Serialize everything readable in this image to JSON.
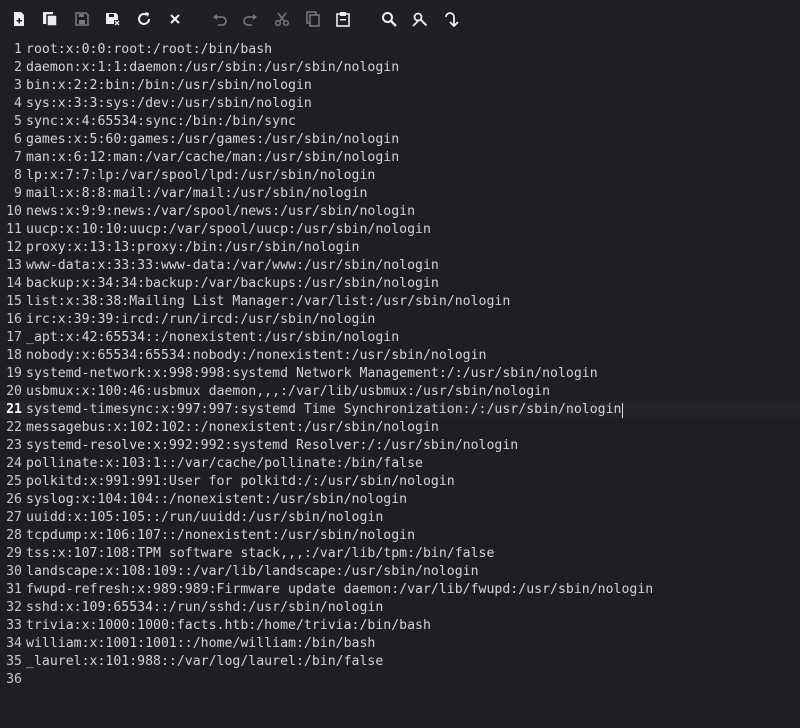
{
  "toolbar": {
    "buttons": [
      {
        "icon": "new-file-icon"
      },
      {
        "icon": "new-window-icon"
      },
      {
        "icon": "save-icon"
      },
      {
        "icon": "save-as-icon"
      },
      {
        "icon": "reload-icon"
      },
      {
        "icon": "close-icon"
      },
      {
        "icon": "undo-icon"
      },
      {
        "icon": "redo-icon"
      },
      {
        "icon": "cut-icon"
      },
      {
        "icon": "copy-icon"
      },
      {
        "icon": "paste-icon"
      },
      {
        "icon": "find-icon"
      },
      {
        "icon": "find-replace-icon"
      },
      {
        "icon": "goto-line-icon"
      }
    ]
  },
  "editor": {
    "active_line": 21,
    "lines": [
      {
        "n": "1",
        "text": "root:x:0:0:root:/root:/bin/bash"
      },
      {
        "n": "2",
        "text": "daemon:x:1:1:daemon:/usr/sbin:/usr/sbin/nologin"
      },
      {
        "n": "3",
        "text": "bin:x:2:2:bin:/bin:/usr/sbin/nologin"
      },
      {
        "n": "4",
        "text": "sys:x:3:3:sys:/dev:/usr/sbin/nologin"
      },
      {
        "n": "5",
        "text": "sync:x:4:65534:sync:/bin:/bin/sync"
      },
      {
        "n": "6",
        "text": "games:x:5:60:games:/usr/games:/usr/sbin/nologin"
      },
      {
        "n": "7",
        "text": "man:x:6:12:man:/var/cache/man:/usr/sbin/nologin"
      },
      {
        "n": "8",
        "text": "lp:x:7:7:lp:/var/spool/lpd:/usr/sbin/nologin"
      },
      {
        "n": "9",
        "text": "mail:x:8:8:mail:/var/mail:/usr/sbin/nologin"
      },
      {
        "n": "10",
        "text": "news:x:9:9:news:/var/spool/news:/usr/sbin/nologin"
      },
      {
        "n": "11",
        "text": "uucp:x:10:10:uucp:/var/spool/uucp:/usr/sbin/nologin"
      },
      {
        "n": "12",
        "text": "proxy:x:13:13:proxy:/bin:/usr/sbin/nologin"
      },
      {
        "n": "13",
        "text": "www-data:x:33:33:www-data:/var/www:/usr/sbin/nologin"
      },
      {
        "n": "14",
        "text": "backup:x:34:34:backup:/var/backups:/usr/sbin/nologin"
      },
      {
        "n": "15",
        "text": "list:x:38:38:Mailing List Manager:/var/list:/usr/sbin/nologin"
      },
      {
        "n": "16",
        "text": "irc:x:39:39:ircd:/run/ircd:/usr/sbin/nologin"
      },
      {
        "n": "17",
        "text": "_apt:x:42:65534::/nonexistent:/usr/sbin/nologin"
      },
      {
        "n": "18",
        "text": "nobody:x:65534:65534:nobody:/nonexistent:/usr/sbin/nologin"
      },
      {
        "n": "19",
        "text": "systemd-network:x:998:998:systemd Network Management:/:/usr/sbin/nologin"
      },
      {
        "n": "20",
        "text": "usbmux:x:100:46:usbmux daemon,,,:/var/lib/usbmux:/usr/sbin/nologin"
      },
      {
        "n": "21",
        "text": "systemd-timesync:x:997:997:systemd Time Synchronization:/:/usr/sbin/nologin"
      },
      {
        "n": "22",
        "text": "messagebus:x:102:102::/nonexistent:/usr/sbin/nologin"
      },
      {
        "n": "23",
        "text": "systemd-resolve:x:992:992:systemd Resolver:/:/usr/sbin/nologin"
      },
      {
        "n": "24",
        "text": "pollinate:x:103:1::/var/cache/pollinate:/bin/false"
      },
      {
        "n": "25",
        "text": "polkitd:x:991:991:User for polkitd:/:/usr/sbin/nologin"
      },
      {
        "n": "26",
        "text": "syslog:x:104:104::/nonexistent:/usr/sbin/nologin"
      },
      {
        "n": "27",
        "text": "uuidd:x:105:105::/run/uuidd:/usr/sbin/nologin"
      },
      {
        "n": "28",
        "text": "tcpdump:x:106:107::/nonexistent:/usr/sbin/nologin"
      },
      {
        "n": "29",
        "text": "tss:x:107:108:TPM software stack,,,:/var/lib/tpm:/bin/false"
      },
      {
        "n": "30",
        "text": "landscape:x:108:109::/var/lib/landscape:/usr/sbin/nologin"
      },
      {
        "n": "31",
        "text": "fwupd-refresh:x:989:989:Firmware update daemon:/var/lib/fwupd:/usr/sbin/nologin"
      },
      {
        "n": "32",
        "text": "sshd:x:109:65534::/run/sshd:/usr/sbin/nologin"
      },
      {
        "n": "33",
        "text": "trivia:x:1000:1000:facts.htb:/home/trivia:/bin/bash"
      },
      {
        "n": "34",
        "text": "william:x:1001:1001::/home/william:/bin/bash"
      },
      {
        "n": "35",
        "text": "_laurel:x:101:988::/var/log/laurel:/bin/false"
      },
      {
        "n": "36",
        "text": ""
      }
    ]
  }
}
